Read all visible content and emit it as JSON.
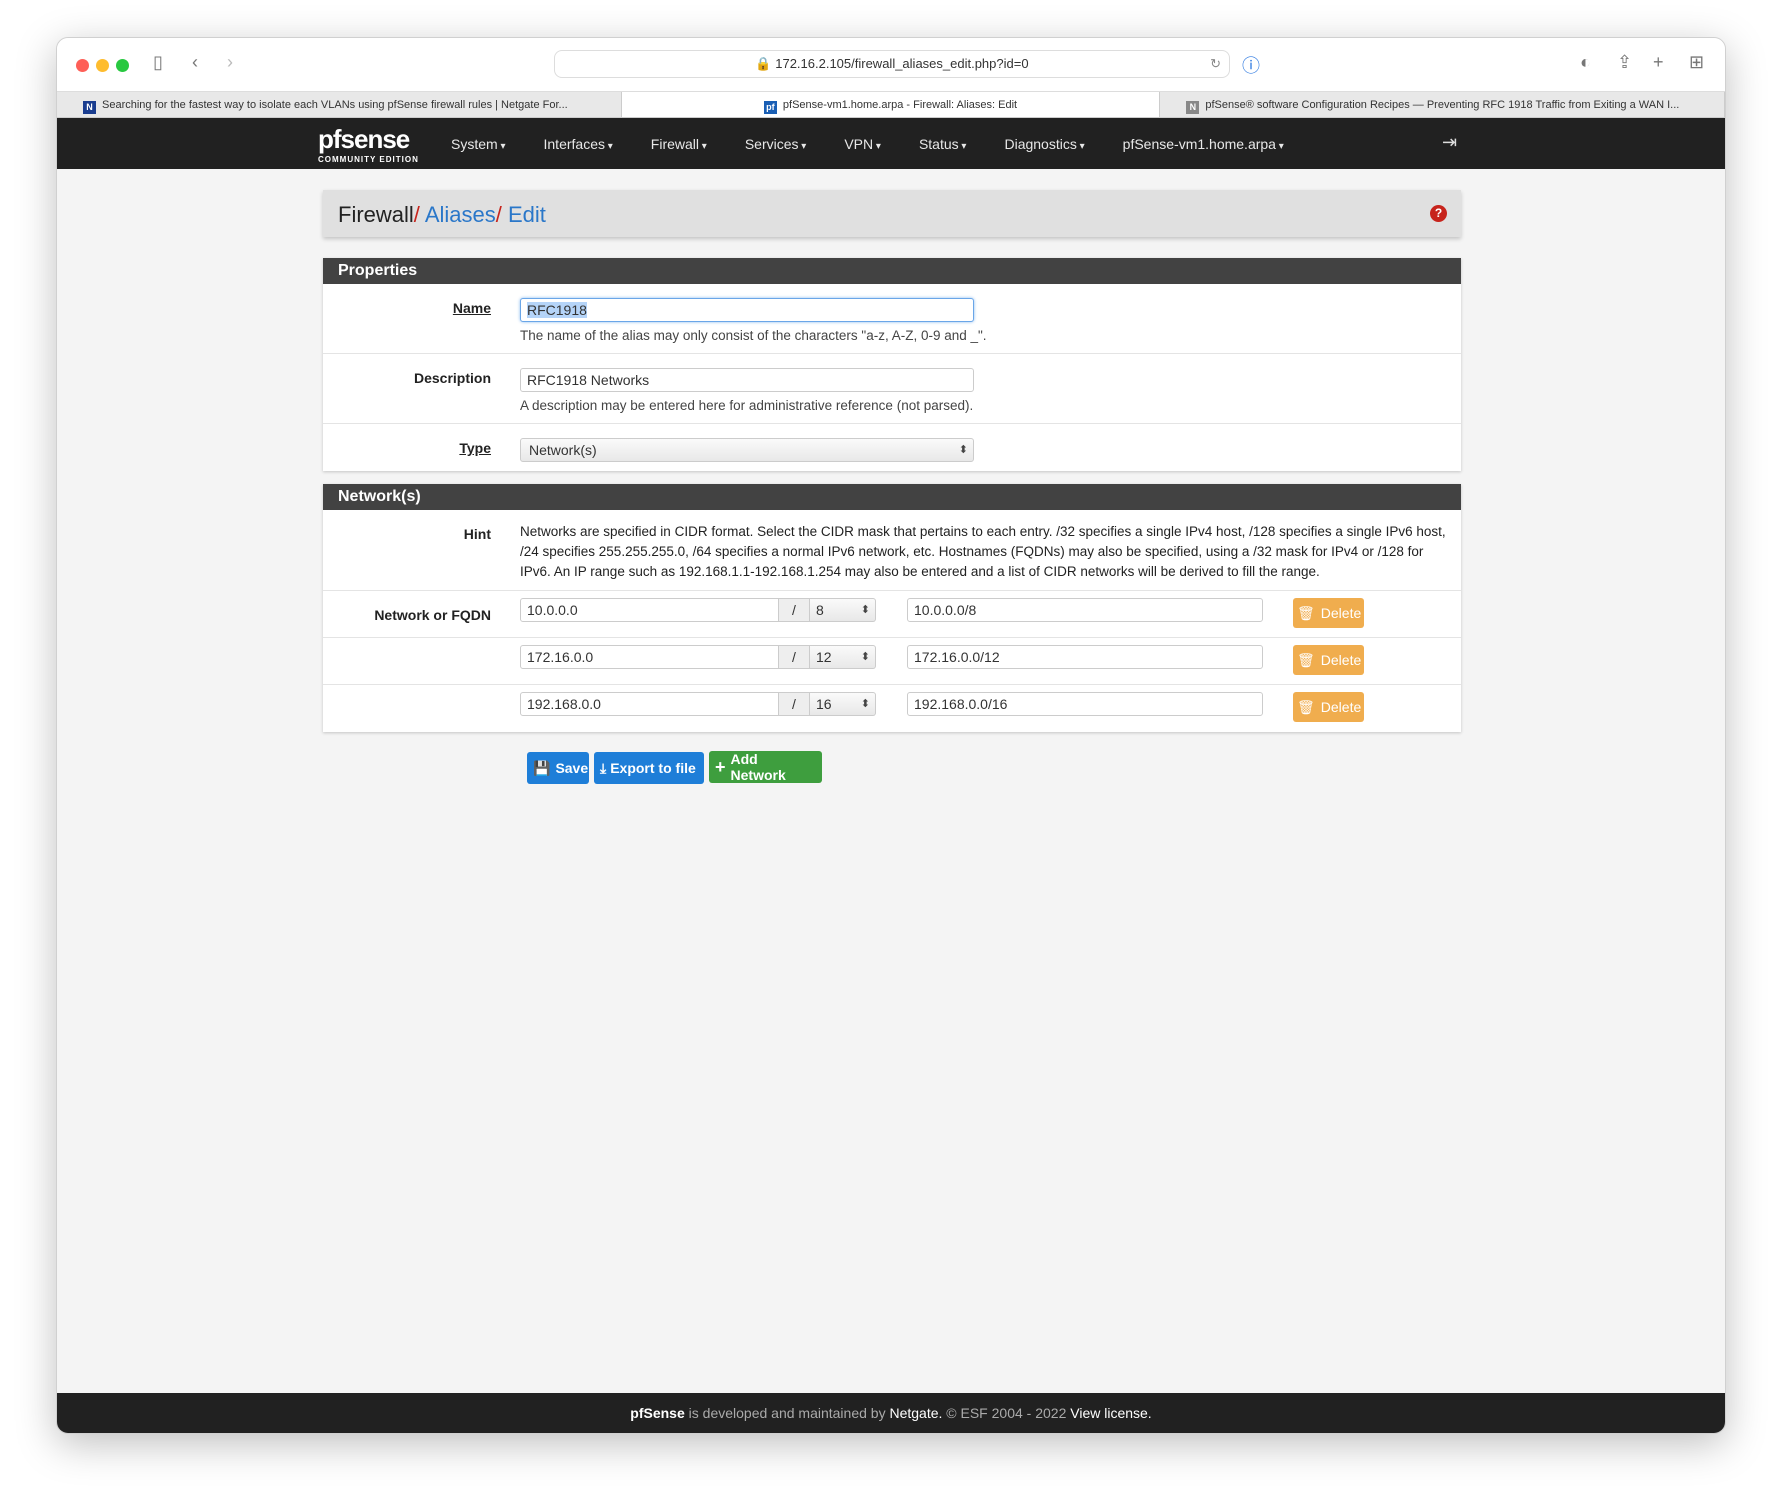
{
  "browser": {
    "url": "172.16.2.105/firewall_aliases_edit.php?id=0",
    "tabs": [
      {
        "title": "Searching for the fastest way to isolate each VLANs using pfSense firewall rules | Netgate For...",
        "favicon": "N"
      },
      {
        "title": "pfSense-vm1.home.arpa - Firewall: Aliases: Edit",
        "favicon": "pf"
      },
      {
        "title": "pfSense® software Configuration Recipes — Preventing RFC 1918 Traffic from Exiting a WAN I...",
        "favicon": "N"
      }
    ]
  },
  "nav": {
    "logo": "pfsense",
    "logo_sub": "COMMUNITY EDITION",
    "items": [
      "System",
      "Interfaces",
      "Firewall",
      "Services",
      "VPN",
      "Status",
      "Diagnostics",
      "pfSense-vm1.home.arpa"
    ]
  },
  "breadcrumb": {
    "root": "Firewall",
    "sep": "/",
    "aliases": "Aliases",
    "edit": "Edit"
  },
  "properties": {
    "title": "Properties",
    "name": {
      "label": "Name",
      "value": "RFC1918",
      "help": "The name of the alias may only consist of the characters \"a-z, A-Z, 0-9 and _\"."
    },
    "description": {
      "label": "Description",
      "value": "RFC1918 Networks",
      "help": "A description may be entered here for administrative reference (not parsed)."
    },
    "type": {
      "label": "Type",
      "value": "Network(s)"
    }
  },
  "networks": {
    "title": "Network(s)",
    "hint_label": "Hint",
    "hint": "Networks are specified in CIDR format. Select the CIDR mask that pertains to each entry. /32 specifies a single IPv4 host, /128 specifies a single IPv6 host, /24 specifies 255.255.255.0, /64 specifies a normal IPv6 network, etc. Hostnames (FQDNs) may also be specified, using a /32 mask for IPv4 or /128 for IPv6. An IP range such as 192.168.1.1-192.168.1.254 may also be entered and a list of CIDR networks will be derived to fill the range.",
    "row_label": "Network or FQDN",
    "slash": "/",
    "delete_label": "Delete",
    "rows": [
      {
        "network": "10.0.0.0",
        "mask": "8",
        "description": "10.0.0.0/8"
      },
      {
        "network": "172.16.0.0",
        "mask": "12",
        "description": "172.16.0.0/12"
      },
      {
        "network": "192.168.0.0",
        "mask": "16",
        "description": "192.168.0.0/16"
      }
    ]
  },
  "actions": {
    "save": "Save",
    "export": "Export to file",
    "add": "Add Network"
  },
  "footer": {
    "brand": "pfSense",
    "text1": " is developed and maintained by ",
    "netgate": "Netgate.",
    "text2": " © ESF 2004 - 2022 ",
    "license": "View license."
  },
  "colors": {
    "nav": "#212121",
    "panel_header": "#424242",
    "link": "#2a77c9",
    "danger": "#c7241c",
    "warning": "#f0ad4e",
    "primary": "#1e7ed8",
    "success": "#3e9e3e"
  }
}
